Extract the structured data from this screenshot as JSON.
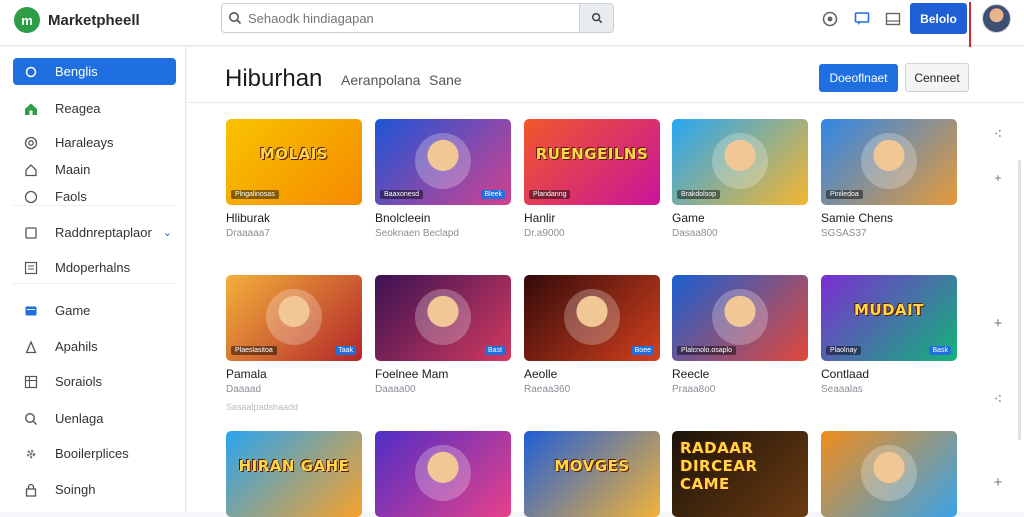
{
  "app": {
    "name": "Marketpheell",
    "logo_letter": "m"
  },
  "search": {
    "placeholder": "Sehaodk hindiagapan",
    "value": ""
  },
  "header": {
    "icons": [
      "help-icon",
      "chat-icon",
      "window-icon"
    ],
    "cta_label": "Belolo"
  },
  "sidebar": {
    "items": [
      {
        "label": "Benglis",
        "icon": "circle-icon",
        "active": true
      },
      {
        "label": "Reagea",
        "icon": "home-icon"
      },
      {
        "label": "Haraleays",
        "icon": "target-icon"
      },
      {
        "label": "Maain",
        "icon": "house-outline-icon"
      },
      {
        "label": "Faols",
        "icon": "circle-outline-icon"
      },
      {
        "label": "Raddnreptaplaor",
        "icon": "box-icon",
        "has_chevron": true
      },
      {
        "label": "Mdoperhalns",
        "icon": "list-icon"
      },
      {
        "label": "Game",
        "icon": "card-icon"
      },
      {
        "label": "Apahils",
        "icon": "bag-icon"
      },
      {
        "label": "Soraiols",
        "icon": "table-icon"
      },
      {
        "label": "Uenlaga",
        "icon": "search-small-icon"
      },
      {
        "label": "Booilerplices",
        "icon": "gear-icon"
      },
      {
        "label": "Soingh",
        "icon": "lock-icon"
      }
    ]
  },
  "page": {
    "title": "Hiburhan",
    "crumb_1": "Aeranpolana",
    "crumb_2": "Sane",
    "primary_button": "Doeoflnaet",
    "secondary_button": "Cenneet"
  },
  "games": [
    {
      "name": "Hliburak",
      "meta": "Draaaaa7",
      "art": "MOLAIS",
      "chip": "Plngalinosas",
      "badge": "",
      "colors": [
        "#f8c300",
        "#f58a00"
      ]
    },
    {
      "name": "Bnolcleein",
      "meta": "Seoknaen Beclapd",
      "art": "",
      "chip": "Baaxonesd",
      "badge": "Bleek",
      "colors": [
        "#1e55d6",
        "#d2418e"
      ]
    },
    {
      "name": "Hanlir",
      "meta": "Dr.a9000",
      "art": "RUENGEILNS",
      "chip": "Plandanng",
      "badge": "",
      "colors": [
        "#f2572a",
        "#c9149c"
      ]
    },
    {
      "name": "Game",
      "meta": "Dasaa800",
      "art": "",
      "chip": "Brakdolsop",
      "badge": "",
      "colors": [
        "#27a7f2",
        "#f6b530"
      ]
    },
    {
      "name": "Samie Chens",
      "meta": "SGSAS37",
      "art": "",
      "chip": "Piniledoa",
      "badge": "",
      "colors": [
        "#2f86e8",
        "#e69a3a"
      ]
    },
    {
      "name": "Pamala",
      "meta": "Daaaad",
      "art": "",
      "chip": "Plaeslasitoa",
      "badge": "Taak",
      "colors": [
        "#f3b03a",
        "#b3262a"
      ]
    },
    {
      "name": "Foelnee Mam",
      "meta": "Daaaa00",
      "art": "",
      "chip": "",
      "badge": "Bast",
      "colors": [
        "#3a1252",
        "#d33a60"
      ]
    },
    {
      "name": "Aeolle",
      "meta": "Raeaa360",
      "art": "",
      "chip": "",
      "badge": "Boee",
      "colors": [
        "#330a0a",
        "#d3401e"
      ]
    },
    {
      "name": "Reecle",
      "meta": "Praaa8o0",
      "art": "",
      "chip": "Plalcnolo.osaplo",
      "badge": "",
      "colors": [
        "#1a5fd1",
        "#e2483a"
      ]
    },
    {
      "name": "Contlaad",
      "meta": "Seaaalas",
      "art": "MUDAIT",
      "chip": "Plaolnay",
      "badge": "Bask",
      "colors": [
        "#7b2ed3",
        "#14b37a"
      ]
    },
    {
      "name": "",
      "meta": "",
      "art": "HIRAN GAHE",
      "chip": "",
      "badge": "",
      "colors": [
        "#29a4f0",
        "#f7a12b"
      ]
    },
    {
      "name": "",
      "meta": "",
      "art": "",
      "chip": "",
      "badge": "",
      "colors": [
        "#4f2ec6",
        "#e7418a"
      ]
    },
    {
      "name": "",
      "meta": "",
      "art": "MOVGES",
      "chip": "",
      "badge": "",
      "colors": [
        "#1f5ed6",
        "#f2b23a"
      ]
    },
    {
      "name": "",
      "meta": "",
      "art": "RADAAR DIRCEAR CAME",
      "chip": "",
      "badge": "",
      "colors": [
        "#1b1408",
        "#6b3a12"
      ]
    },
    {
      "name": "",
      "meta": "",
      "art": "",
      "chip": "",
      "badge": "",
      "colors": [
        "#f08c1c",
        "#3aa3e8"
      ]
    }
  ],
  "row_note": "Sasaalpadshaadd",
  "right_rail_icons": [
    "quote-icon",
    "plus-small-icon",
    "plus-icon",
    "quote-icon",
    "plus-icon"
  ]
}
